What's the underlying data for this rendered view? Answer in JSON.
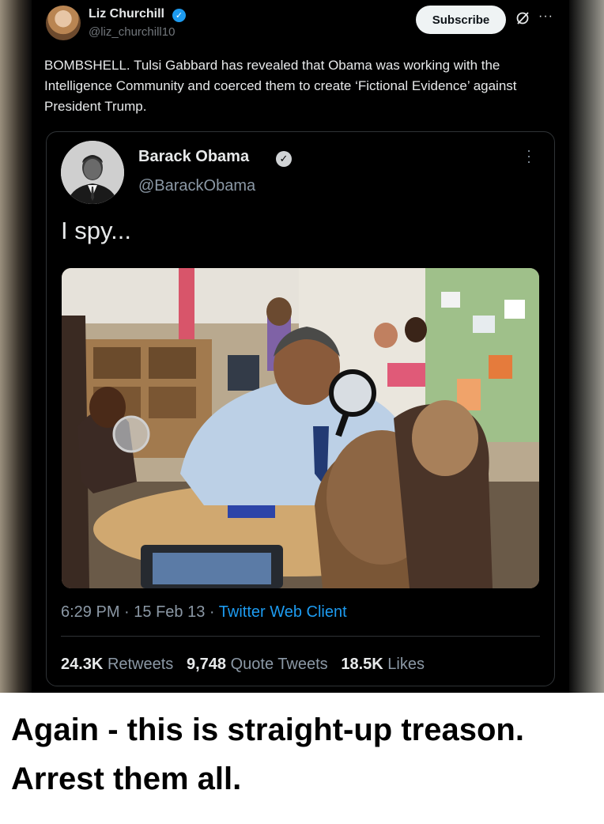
{
  "post": {
    "author": {
      "name": "Liz Churchill",
      "handle": "@liz_churchill10",
      "verified": true
    },
    "subscribe_label": "Subscribe",
    "icons": {
      "grok": "grok-icon",
      "more": "more-icon"
    },
    "text": "BOMBSHELL. Tulsi Gabbard has revealed that Obama was working with the Intelligence Community and coerced them to create ‘Fictional Evidence’ against President Trump."
  },
  "quoted": {
    "author": {
      "name": "Barack Obama",
      "handle": "@BarackObama",
      "verified": true
    },
    "text": "I spy...",
    "photo": "photo of a man with a magnifying glass at a classroom table with children",
    "time": "6:29 PM",
    "date": "15 Feb 13",
    "client": "Twitter Web Client",
    "sep": " · ",
    "stats": [
      {
        "value": "24.3K",
        "label": "Retweets"
      },
      {
        "value": "9,748",
        "label": "Quote Tweets"
      },
      {
        "value": "18.5K",
        "label": "Likes"
      }
    ]
  },
  "caption": {
    "line1": "Again - this is straight-up treason.",
    "line2": "Arrest them all."
  },
  "colors": {
    "background": "#000000",
    "text": "#e7e9ea",
    "muted": "#71767b",
    "link": "#1d9bf0",
    "verified": "#1d9bf0"
  }
}
